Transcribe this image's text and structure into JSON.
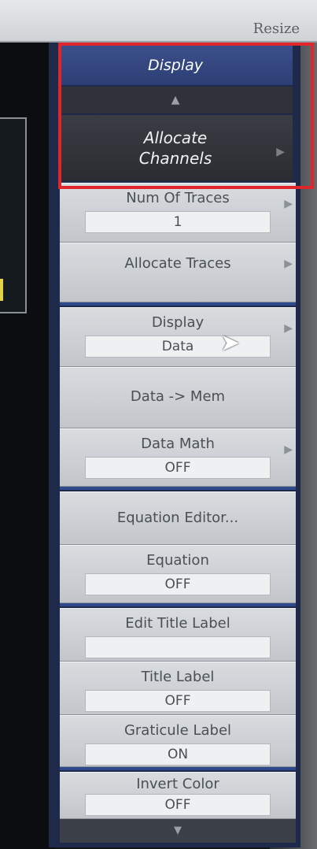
{
  "topbar": {
    "resize_label": "Resize"
  },
  "menu": {
    "header": "Display",
    "allocate_channels": "Allocate Channels",
    "keys": [
      {
        "label": "Num Of Traces",
        "value": "1"
      },
      {
        "label": "Allocate Traces"
      },
      {
        "label": "Display",
        "value": "Data"
      },
      {
        "label": "Data -> Mem"
      },
      {
        "label": "Data Math",
        "value": "OFF"
      },
      {
        "label": "Equation Editor..."
      },
      {
        "label": "Equation",
        "value": "OFF"
      },
      {
        "label": "Edit Title Label",
        "value": ""
      },
      {
        "label": "Title Label",
        "value": "OFF"
      },
      {
        "label": "Graticule Label",
        "value": "ON"
      },
      {
        "label": "Invert Color",
        "value": "OFF"
      }
    ]
  },
  "colors": {
    "highlight": "#e0262b",
    "header": "#2c3e74",
    "separator": "#2e4a8c"
  },
  "icons": [
    "scroll-up-arrow-icon",
    "scroll-down-arrow-icon",
    "submenu-arrow-icon",
    "mouse-pointer-icon"
  ]
}
